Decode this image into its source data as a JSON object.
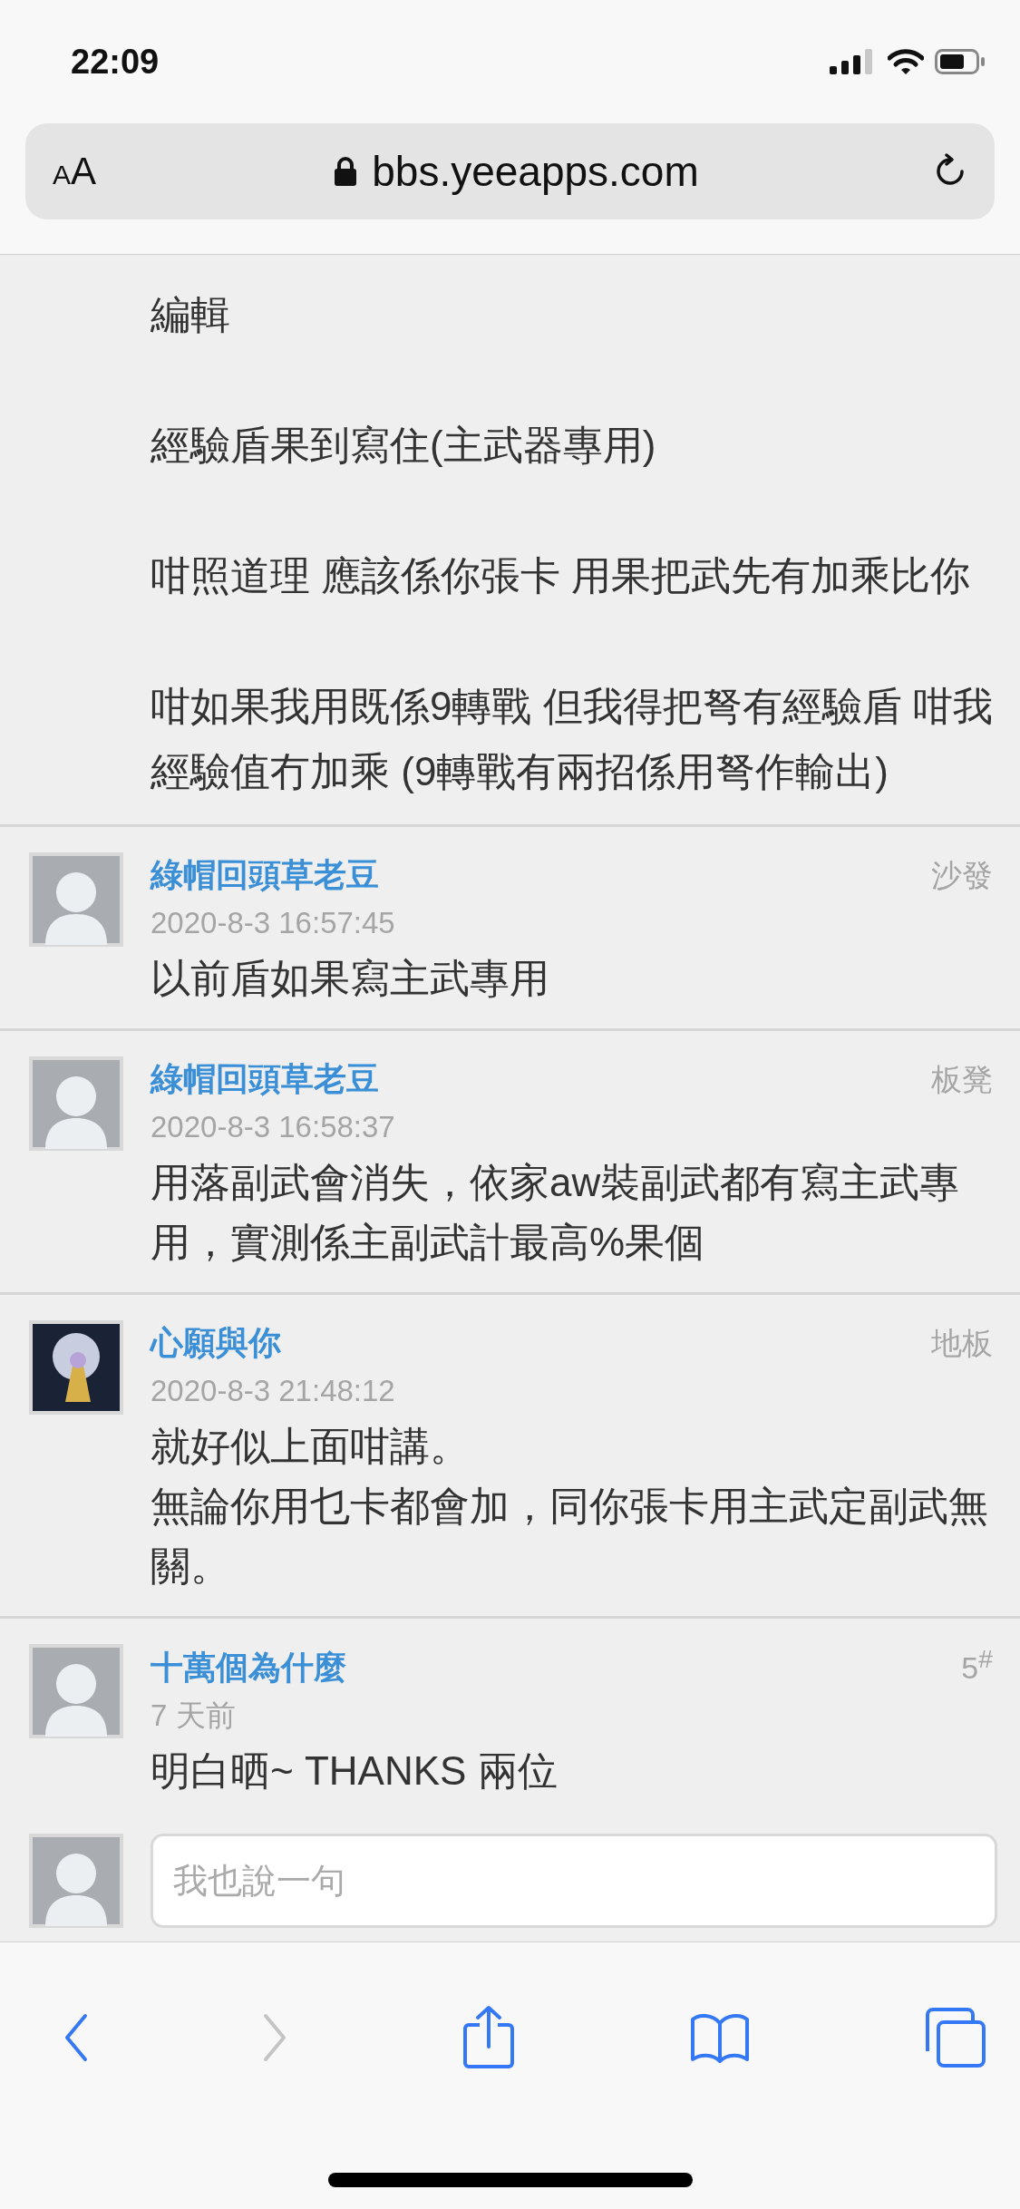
{
  "status_bar": {
    "time": "22:09"
  },
  "address_bar": {
    "text_size_button": "AA",
    "url": "bbs.yeeapps.com"
  },
  "first_post": {
    "paragraphs": [
      "編輯",
      "經驗盾果到寫住(主武器專用)",
      "咁照道理 應該係你張卡 用果把武先有加乘比你",
      "咁如果我用既係9轉戰 但我得把弩有經驗盾 咁我經驗值冇加乘 (9轉戰有兩招係用弩作輸出)"
    ]
  },
  "replies": [
    {
      "avatar": {
        "kind": "default"
      },
      "username": "綠帽回頭草老豆",
      "floor": "沙發",
      "time": "2020-8-3 16:57:45",
      "lines": [
        "以前盾如果寫主武專用"
      ]
    },
    {
      "avatar": {
        "kind": "default"
      },
      "username": "綠帽回頭草老豆",
      "floor": "板凳",
      "time": "2020-8-3 16:58:37",
      "lines": [
        "用落副武會消失，依家aw裝副武都有寫主武專用，實測係主副武計最高%果個"
      ]
    },
    {
      "avatar": {
        "kind": "picture"
      },
      "username": "心願與你",
      "floor": "地板",
      "time": "2020-8-3 21:48:12",
      "lines": [
        "就好似上面咁講。",
        "無論你用乜卡都會加，同你張卡用主武定副武無關。"
      ]
    },
    {
      "avatar": {
        "kind": "default"
      },
      "username": "十萬個為什麼",
      "floor": "5$^{#}$",
      "time": "7 天前",
      "lines": [
        "明白晒~ THANKS 兩位"
      ]
    }
  ],
  "reply_box": {
    "avatar": {
      "kind": "default"
    },
    "placeholder": "我也說一句"
  },
  "toolbar": [
    {
      "kind": "back",
      "disabled": false
    },
    {
      "kind": "forward",
      "disabled": true
    },
    {
      "kind": "share",
      "disabled": false
    },
    {
      "kind": "bookmarks",
      "disabled": false
    },
    {
      "kind": "tabs",
      "disabled": false
    }
  ]
}
